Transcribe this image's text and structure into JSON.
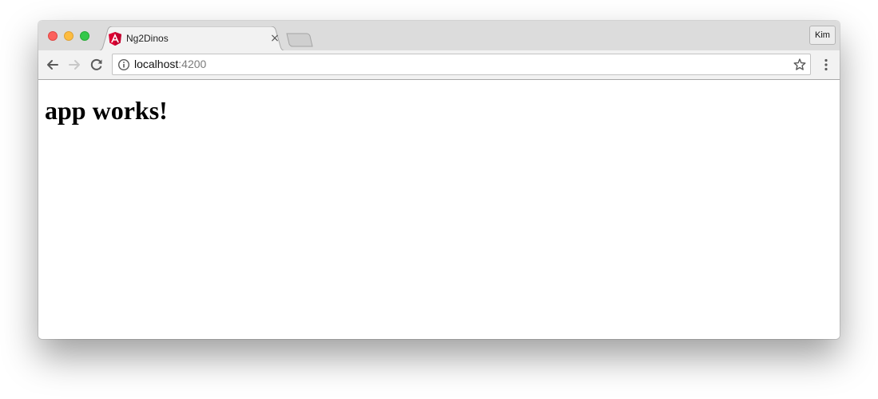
{
  "browser": {
    "tab": {
      "title": "Ng2Dinos",
      "favicon": "angular-icon",
      "close": "×"
    },
    "profile_label": "Kim",
    "address": {
      "host": "localhost",
      "port": ":4200"
    }
  },
  "page": {
    "heading": "app works!"
  },
  "colors": {
    "close": "#fc605c",
    "minimize": "#fdbc40",
    "maximize": "#34c84a",
    "angular_red": "#dd0031"
  }
}
